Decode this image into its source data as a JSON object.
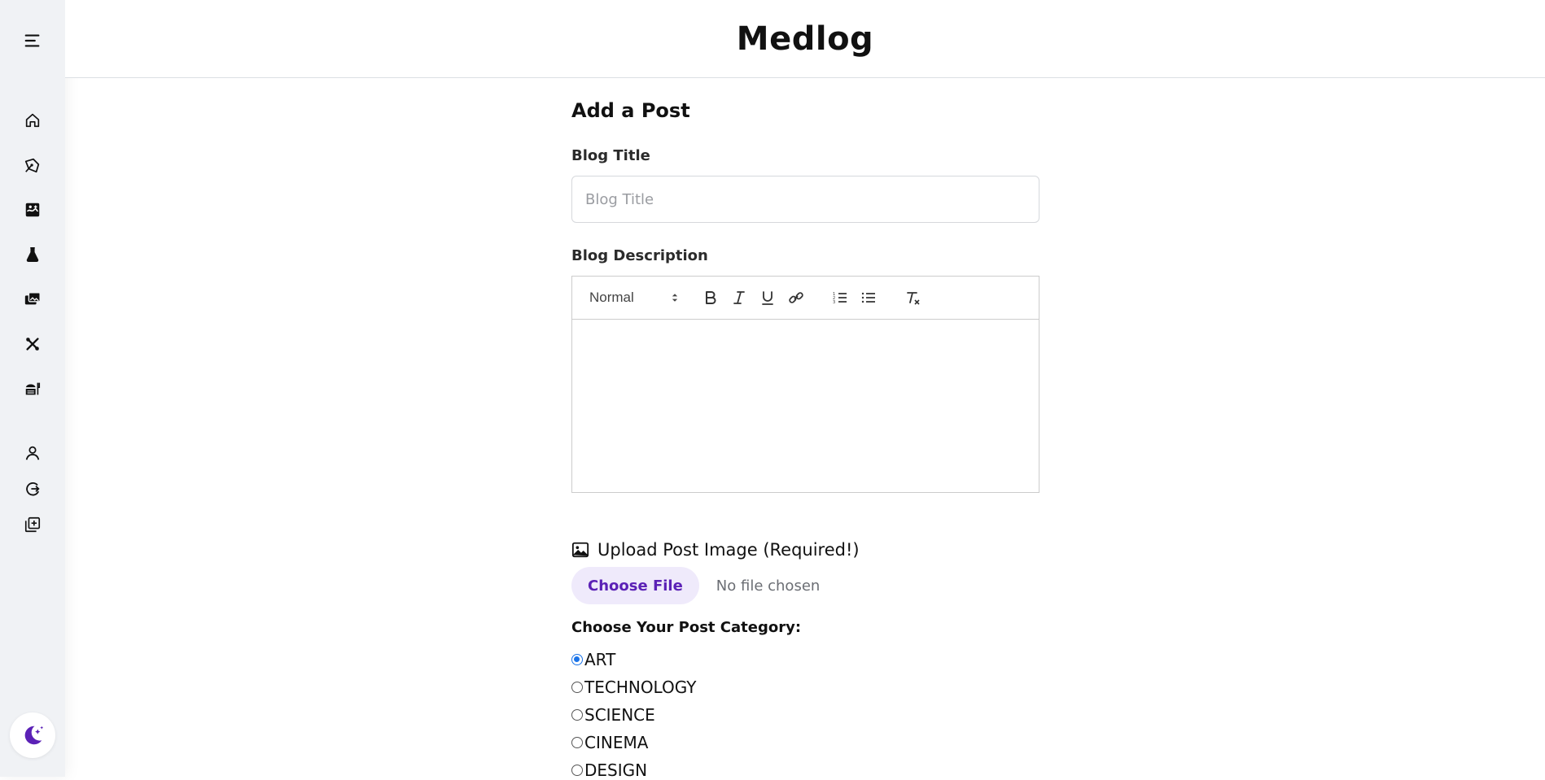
{
  "brand": "Medlog",
  "sidebar": {
    "icons": [
      "menu-icon",
      "home-icon",
      "pen-tool-icon",
      "image-gallery-icon",
      "flask-icon",
      "photos-icon",
      "tools-icon",
      "food-icon",
      "user-icon",
      "logout-icon",
      "add-post-icon"
    ],
    "theme_icon": "moon-stars-icon",
    "accent_color": "#5b21b6"
  },
  "form": {
    "page_title": "Add a Post",
    "blog_title_label": "Blog Title",
    "blog_title_placeholder": "Blog Title",
    "blog_title_value": "",
    "blog_description_label": "Blog Description",
    "editor": {
      "format_value": "Normal",
      "tools": [
        "bold",
        "italic",
        "underline",
        "link",
        "ordered-list",
        "bullet-list",
        "clear-format"
      ]
    },
    "upload_label": "Upload Post Image (Required!)",
    "choose_file_label": "Choose File",
    "no_file_text": "No file chosen",
    "category_label": "Choose Your Post Category:",
    "categories": [
      {
        "label": "ART",
        "checked": true
      },
      {
        "label": "TECHNOLOGY",
        "checked": false
      },
      {
        "label": "SCIENCE",
        "checked": false
      },
      {
        "label": "CINEMA",
        "checked": false
      },
      {
        "label": "DESIGN",
        "checked": false
      }
    ]
  }
}
